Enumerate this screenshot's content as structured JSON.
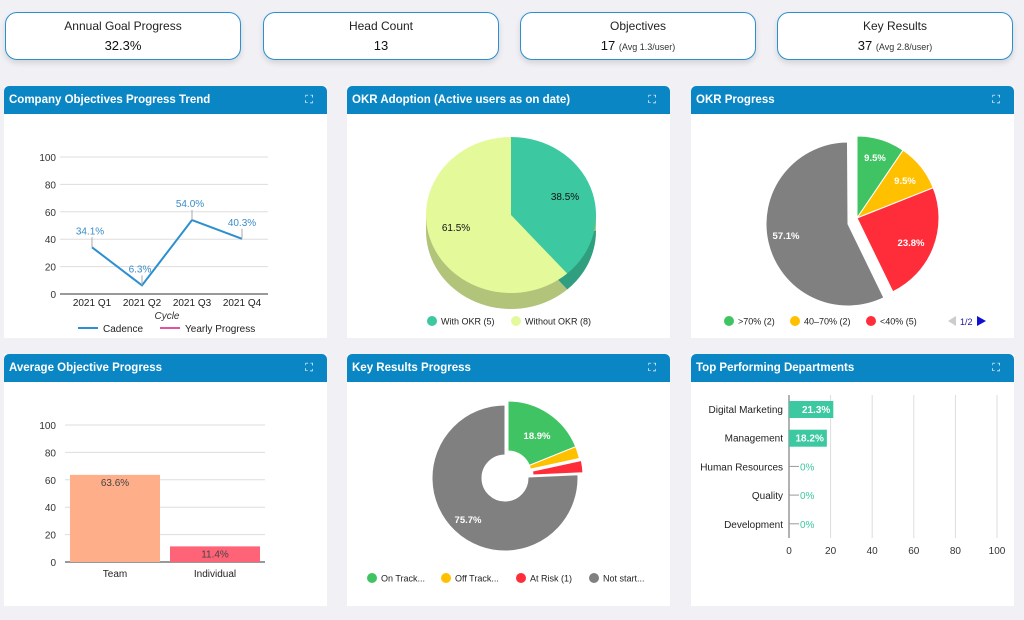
{
  "kpis": [
    {
      "label": "Annual Goal Progress",
      "value": "32.3%",
      "sub": ""
    },
    {
      "label": "Head Count",
      "value": "13",
      "sub": ""
    },
    {
      "label": "Objectives",
      "value": "17",
      "sub": "(Avg 1.3/user)"
    },
    {
      "label": "Key Results",
      "value": "37",
      "sub": "(Avg 2.8/user)"
    }
  ],
  "panels": {
    "trend": "Company Objectives Progress Trend",
    "adoption": "OKR Adoption (Active users as on date)",
    "okr": "OKR Progress",
    "avg": "Average Objective Progress",
    "kr": "Key Results Progress",
    "dept": "Top Performing Departments"
  },
  "expand_icon": "expand-icon",
  "chart_data": [
    {
      "id": "trend",
      "type": "line",
      "categories": [
        "2021 Q1",
        "2021 Q2",
        "2021 Q3",
        "2021 Q4"
      ],
      "series": [
        {
          "name": "Cadence",
          "values": [
            34.1,
            6.3,
            54.0,
            40.3
          ],
          "labels": [
            "34.1%",
            "6.3%",
            "54.0%",
            "40.3%"
          ],
          "color": "#2b8fd0"
        },
        {
          "name": "Yearly Progress",
          "values": [],
          "color": "#e0559a"
        }
      ],
      "xlabel": "Cycle",
      "ylim": [
        0,
        100
      ],
      "yticks": [
        "0",
        "20",
        "40",
        "60",
        "80",
        "100"
      ],
      "grid": true,
      "legend": "bottom"
    },
    {
      "id": "adoption",
      "type": "pie",
      "slices": [
        {
          "name": "With OKR (5)",
          "value": 38.5,
          "label": "38.5%",
          "color": "#3cc8a0"
        },
        {
          "name": "Without OKR (8)",
          "value": 61.5,
          "label": "61.5%",
          "color": "#e4fa9a"
        }
      ],
      "legend": "bottom"
    },
    {
      "id": "okr",
      "type": "pie",
      "slices": [
        {
          "name": ">70% (2)",
          "value": 9.5,
          "label": "9.5%",
          "color": "#40c463"
        },
        {
          "name": "40–70% (2)",
          "value": 9.5,
          "label": "9.5%",
          "color": "#ffc000"
        },
        {
          "name": "<40% (5)",
          "value": 23.8,
          "label": "23.8%",
          "color": "#ff2d3a"
        },
        {
          "name": "",
          "value": 57.1,
          "label": "57.1%",
          "color": "#808080"
        }
      ],
      "legend": "bottom",
      "legend_page": "1/2"
    },
    {
      "id": "avg",
      "type": "bar",
      "categories": [
        "Team",
        "Individual"
      ],
      "values": [
        63.6,
        11.4
      ],
      "labels": [
        "63.6%",
        "11.4%"
      ],
      "colors": [
        "#ffae8a",
        "#ff6377"
      ],
      "ylim": [
        0,
        100
      ],
      "yticks": [
        "0",
        "20",
        "40",
        "60",
        "80",
        "100"
      ],
      "grid": true
    },
    {
      "id": "kr",
      "type": "pie",
      "donut": true,
      "slices": [
        {
          "name": "On Track...",
          "value": 18.9,
          "label": "18.9%",
          "color": "#40c463"
        },
        {
          "name": "Off Track...",
          "value": 2.7,
          "label": "",
          "color": "#ffc000"
        },
        {
          "name": "At Risk (1)",
          "value": 2.7,
          "label": "",
          "color": "#ff2d3a"
        },
        {
          "name": "Not start...",
          "value": 75.7,
          "label": "75.7%",
          "color": "#808080"
        }
      ],
      "legend": "bottom"
    },
    {
      "id": "dept",
      "type": "bar",
      "orientation": "horizontal",
      "categories": [
        "Digital Marketing",
        "Management",
        "Human Resources",
        "Quality",
        "Development"
      ],
      "values": [
        21.3,
        18.2,
        0,
        0,
        0
      ],
      "labels": [
        "21.3%",
        "18.2%",
        "0%",
        "0%",
        "0%"
      ],
      "color": "#3cc8a0",
      "xlim": [
        0,
        100
      ],
      "xticks": [
        "0",
        "20",
        "40",
        "60",
        "80",
        "100"
      ],
      "grid": true
    }
  ]
}
